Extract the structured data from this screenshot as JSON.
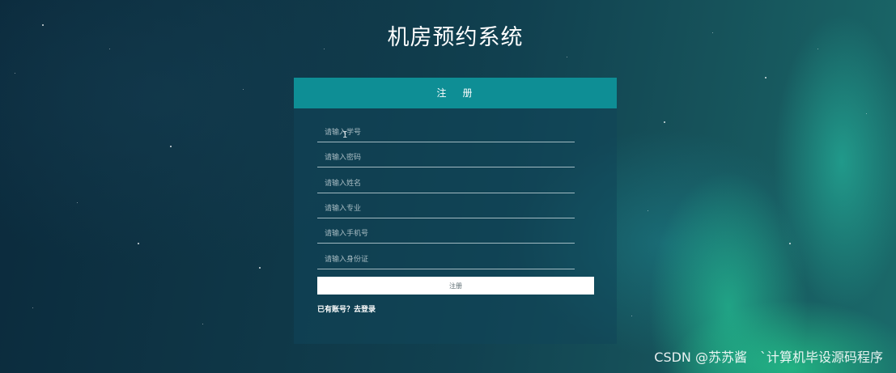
{
  "page": {
    "title": "机房预约系统"
  },
  "form": {
    "header": {
      "word1": "注",
      "word2": "册"
    },
    "fields": [
      {
        "placeholder": "请输入学号"
      },
      {
        "placeholder": "请输入密码"
      },
      {
        "placeholder": "请输入姓名"
      },
      {
        "placeholder": "请输入专业"
      },
      {
        "placeholder": "请输入手机号"
      },
      {
        "placeholder": "请输入身份证"
      }
    ],
    "submit_label": "注册",
    "login_prompt": "已有账号？",
    "login_link": "去登录"
  },
  "watermark": "CSDN @苏苏酱　`计算机毕设源码程序",
  "colors": {
    "header_bg": "#0e8e95",
    "panel_bg": "rgba(16,70,90,0.55)",
    "submit_bg": "#ffffff"
  }
}
